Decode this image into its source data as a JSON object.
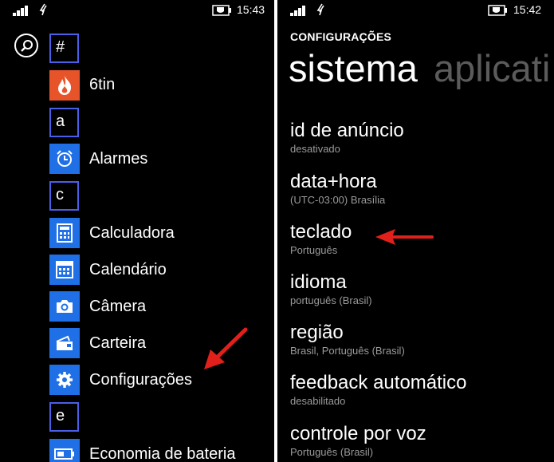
{
  "left_screen": {
    "status_bar": {
      "time": "15:43",
      "signal_icon": "signal-bars-icon",
      "network_icon": "data-sense-icon",
      "battery_icon": "battery-saver-icon"
    },
    "search_icon": "search-icon",
    "groups": [
      {
        "letter": "#",
        "apps": [
          {
            "label": "6tin",
            "icon": "flame-icon",
            "color": "#e8542a"
          }
        ]
      },
      {
        "letter": "a",
        "apps": [
          {
            "label": "Alarmes",
            "icon": "alarm-clock-icon",
            "color": "#1f6fe6"
          }
        ]
      },
      {
        "letter": "c",
        "apps": [
          {
            "label": "Calculadora",
            "icon": "calculator-icon",
            "color": "#1f6fe6"
          },
          {
            "label": "Calendário",
            "icon": "calendar-icon",
            "color": "#1f6fe6"
          },
          {
            "label": "Câmera",
            "icon": "camera-icon",
            "color": "#1f6fe6"
          },
          {
            "label": "Carteira",
            "icon": "wallet-icon",
            "color": "#1f6fe6"
          },
          {
            "label": "Configurações",
            "icon": "gear-icon",
            "color": "#1f6fe6"
          }
        ]
      },
      {
        "letter": "e",
        "apps": [
          {
            "label": "Economia de bateria",
            "icon": "battery-icon",
            "color": "#1f6fe6"
          }
        ]
      }
    ],
    "annotation": {
      "arrow_color": "#e0201b",
      "target": "Configurações"
    }
  },
  "right_screen": {
    "status_bar": {
      "time": "15:42",
      "signal_icon": "signal-bars-icon",
      "network_icon": "data-sense-icon",
      "battery_icon": "battery-saver-icon"
    },
    "breadcrumb": "CONFIGURAÇÕES",
    "pivot": {
      "active": "sistema",
      "next": "aplicati"
    },
    "settings": [
      {
        "title": "id de anúncio",
        "subtitle": "desativado"
      },
      {
        "title": "data+hora",
        "subtitle": "(UTC-03:00) Brasília"
      },
      {
        "title": "teclado",
        "subtitle": "Português"
      },
      {
        "title": "idioma",
        "subtitle": "português (Brasil)"
      },
      {
        "title": "região",
        "subtitle": "Brasil, Português (Brasil)"
      },
      {
        "title": "feedback automático",
        "subtitle": "desabilitado"
      },
      {
        "title": "controle por voz",
        "subtitle": "Português (Brasil)"
      }
    ],
    "annotation": {
      "arrow_color": "#e0201b",
      "target": "teclado"
    }
  },
  "colors": {
    "accent": "#4a5fe8",
    "tile": "#1f6fe6",
    "flame_tile": "#e8542a",
    "subtitle": "#9a9a9a",
    "pivot_inactive": "#5b5b5b",
    "arrow": "#e0201b"
  }
}
